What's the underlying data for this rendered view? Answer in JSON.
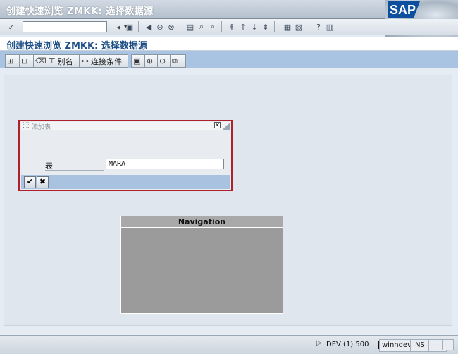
{
  "window": {
    "title": "创建快速浏览 ZMKK: 选择数据源",
    "logo_text": "SAP"
  },
  "command_field": {
    "value": "",
    "dropdown_glyph": "▾"
  },
  "page_title": "创建快速浏览 ZMKK: 选择数据源",
  "app_toolbar": {
    "alias_label": "别名",
    "join_label": "连接条件"
  },
  "dialog": {
    "title": "添加表",
    "field_label": "表",
    "field_value": "MARA",
    "close_glyph": "✕",
    "ok_glyph": "✔",
    "cancel_glyph": "✖"
  },
  "navigation": {
    "header": "Navigation"
  },
  "status_bar": {
    "arrow": "▷",
    "system": "DEV (1) 500",
    "server": "winndev",
    "mode": "INS"
  },
  "colors": {
    "accent_blue": "#a9c4e2",
    "dialog_border": "#b0202a",
    "title_text": "#1d4f86"
  }
}
